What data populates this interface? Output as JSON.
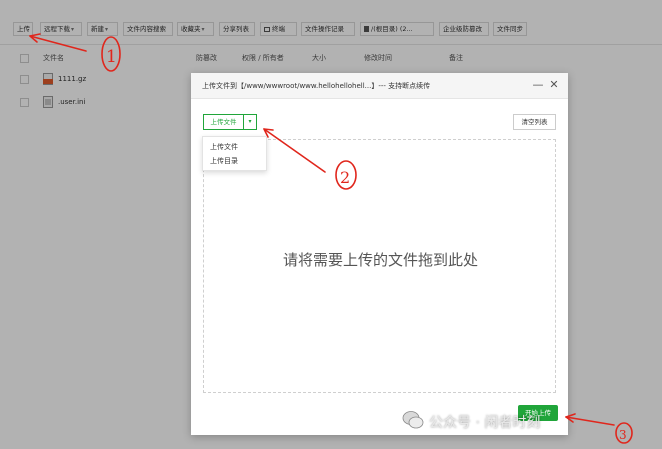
{
  "toolbar": {
    "items": [
      {
        "label": "上传",
        "caret": false
      },
      {
        "label": "远程下载",
        "caret": true
      },
      {
        "label": "新建",
        "caret": true
      },
      {
        "label": "文件内容搜索",
        "caret": false
      },
      {
        "label": "收藏夹",
        "caret": true
      },
      {
        "label": "分享列表",
        "caret": false
      },
      {
        "label": "终端",
        "caret": false
      },
      {
        "label": "文件操作记录",
        "caret": false
      },
      {
        "label": "/(根目录) (2...",
        "caret": false
      },
      {
        "label": "企业级防篡改",
        "caret": false
      },
      {
        "label": "文件同步",
        "caret": false
      }
    ]
  },
  "table": {
    "columns": [
      "文件名",
      "防篡改",
      "权限 / 所有者",
      "大小",
      "修改时间",
      "备注"
    ],
    "files": [
      {
        "name": "1111.gz",
        "icon": "archive-file-icon"
      },
      {
        "name": ".user.ini",
        "icon": "text-file-icon"
      }
    ]
  },
  "modal": {
    "title": "上传文件到【/www/wwwroot/www.hellohellohell...】--- 支持断点续传",
    "upload_button": "上传文件",
    "clear_button": "清空列表",
    "dropdown_items": [
      "上传文件",
      "上传目录"
    ],
    "drop_text": "请将需要上传的文件拖到此处",
    "start_button": "开始上传",
    "minimize_symbol": "—",
    "close_symbol": "✕"
  },
  "annotations": {
    "numbers": [
      "1",
      "2",
      "3"
    ],
    "color": "#e0261c"
  },
  "watermark": {
    "text": "公众号 · 闲者时刻"
  },
  "colors": {
    "accent_green": "#20a53a"
  }
}
